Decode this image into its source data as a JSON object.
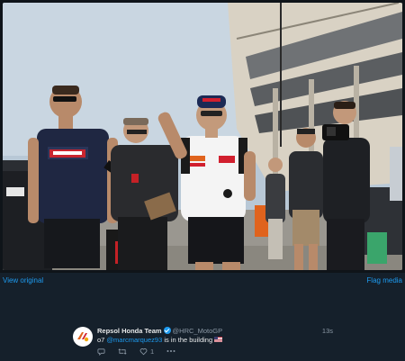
{
  "media": {
    "alt": "Marc Marquez walking through the paddock with team members and a camera crew"
  },
  "links": {
    "view_original": "View original",
    "flag_media": "Flag media"
  },
  "tweet": {
    "author": "Repsol Honda Team",
    "handle": "@HRC_MotoGP",
    "time": "13s",
    "text_prefix": "o7 ",
    "mention": "@marcmarquez93",
    "text_suffix": " is in the building",
    "flag_icon": "us-flag-emoji",
    "like_count": "1"
  },
  "colors": {
    "background": "#15202b",
    "link": "#1d9bf0",
    "muted": "#8b98a5",
    "text": "#e7e9ea"
  }
}
